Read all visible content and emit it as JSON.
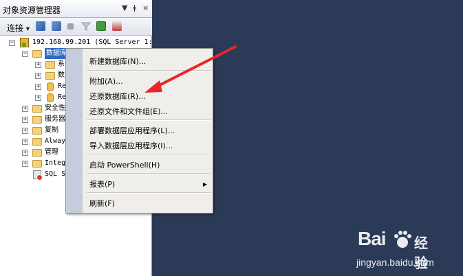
{
  "panel": {
    "title": "对象资源管理器",
    "controls": [
      "▼",
      "ǂ",
      "×"
    ]
  },
  "toolbar": {
    "connect_label": "连接",
    "dropdown_glyph": "▾"
  },
  "tree": {
    "server_label": "192.168.99.201 (SQL Server 1:",
    "databases_label": "数据库",
    "children": [
      "系",
      "数",
      "Re",
      "Re"
    ],
    "top_nodes": [
      "安全性",
      "服务器",
      "复制",
      "Alway",
      "管理",
      "Integ"
    ],
    "sql_agent_label": "SQL S"
  },
  "context_menu": {
    "items": [
      {
        "label": "新建数据库(N)..."
      },
      {
        "label": "附加(A)..."
      },
      {
        "label": "还原数据库(R)..."
      },
      {
        "label": "还原文件和文件组(E)..."
      },
      {
        "label": "部署数据层应用程序(L)..."
      },
      {
        "label": "导入数据层应用程序(I)..."
      },
      {
        "label": "启动 PowerShell(H)"
      },
      {
        "label": "报表(P)"
      },
      {
        "label": "刷新(F)"
      }
    ],
    "submenu_arrow": "▶"
  },
  "watermark": {
    "brand": "Bai",
    "brand_suffix": "经验",
    "url": "jingyan.baidu.com"
  },
  "colors": {
    "background": "#2b3a57",
    "selection": "#3169c6",
    "arrow": "#e8272b"
  }
}
